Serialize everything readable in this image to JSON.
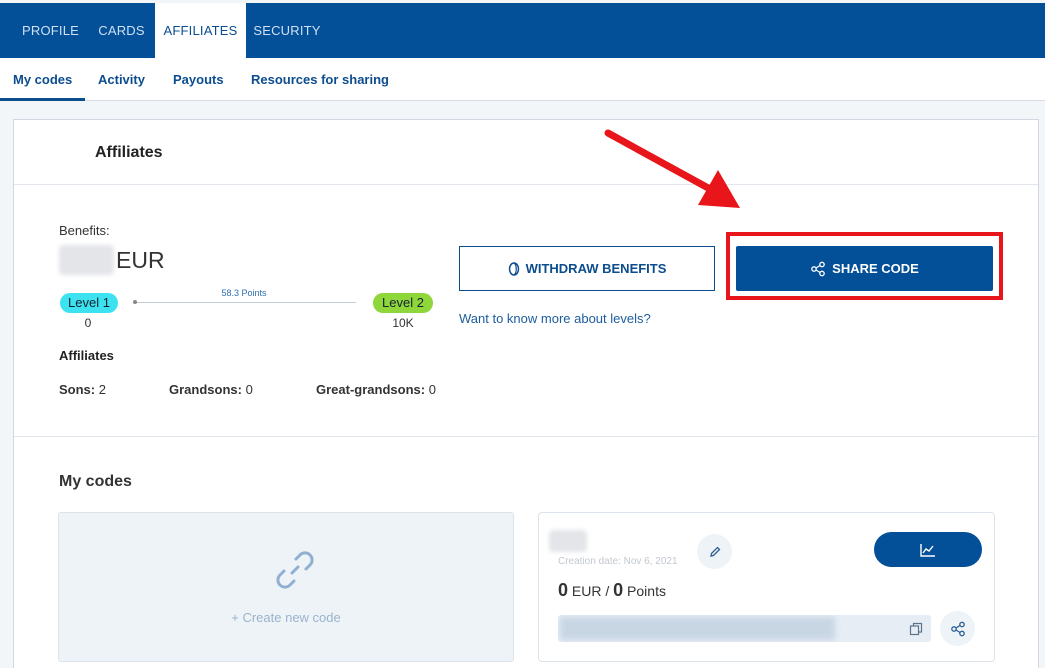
{
  "top_tabs": [
    {
      "label": "PROFILE"
    },
    {
      "label": "CARDS"
    },
    {
      "label": "AFFILIATES",
      "active": true
    },
    {
      "label": "SECURITY"
    }
  ],
  "sub_tabs": [
    {
      "label": "My codes",
      "active": true
    },
    {
      "label": "Activity"
    },
    {
      "label": "Payouts"
    },
    {
      "label": "Resources for sharing"
    }
  ],
  "affiliates": {
    "title": "Affiliates",
    "benefits_label": "Benefits:",
    "currency": "EUR",
    "level1_label": "Level 1",
    "level1_value": "0",
    "level2_label": "Level 2",
    "level2_value": "10K",
    "points_progress": "58.3 Points",
    "progress_fraction": 0.0058,
    "section_title": "Affiliates",
    "sons_label": "Sons:",
    "sons_value": "2",
    "grandsons_label": "Grandsons:",
    "grandsons_value": "0",
    "great_grandsons_label": "Great-grandsons:",
    "great_grandsons_value": "0",
    "withdraw_button": "WITHDRAW BENEFITS",
    "share_button": "SHARE CODE",
    "levels_link": "Want to know more about levels?"
  },
  "my_codes": {
    "title": "My codes",
    "create_label": "+ Create new code",
    "code_card": {
      "creation_date": "Creation date: Nov 6, 2021",
      "eur_value": "0",
      "eur_unit": "EUR",
      "separator": "/",
      "points_value": "0",
      "points_unit": "Points"
    }
  },
  "colors": {
    "primary": "#034f98",
    "level1": "#3ce2f0",
    "level2": "#8fd63a",
    "annotation": "#e8161b"
  },
  "icons": {
    "withdraw": "coin-icon",
    "share": "share-icon",
    "create": "link-icon",
    "edit": "pencil-icon",
    "stats": "chart-icon",
    "copy": "copy-icon"
  }
}
